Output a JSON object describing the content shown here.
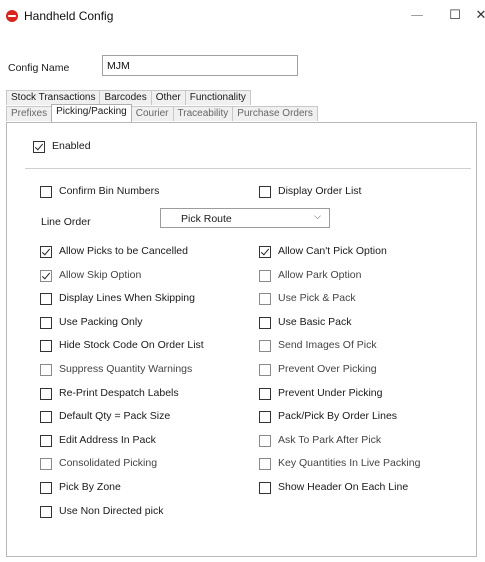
{
  "window": {
    "title": "Handheld Config",
    "minimize": "—",
    "maximize": "☐",
    "close": "✕"
  },
  "config": {
    "label": "Config Name",
    "value": "MJM"
  },
  "tabs_row1": [
    {
      "label": "Stock Transactions"
    },
    {
      "label": "Barcodes"
    },
    {
      "label": "Other"
    },
    {
      "label": "Functionality"
    }
  ],
  "tabs_row2": [
    {
      "label": "Prefixes",
      "active": false
    },
    {
      "label": "Picking/Packing",
      "active": true
    },
    {
      "label": "Courier",
      "active": false
    },
    {
      "label": "Traceability",
      "active": false
    },
    {
      "label": "Purchase Orders",
      "active": false
    }
  ],
  "enabled": {
    "label": "Enabled",
    "checked": true
  },
  "line_order": {
    "label": "Line Order",
    "value": "Pick Route"
  },
  "options": {
    "confirm_bin": {
      "label": "Confirm Bin Numbers",
      "checked": false
    },
    "display_order_list": {
      "label": "Display Order List",
      "checked": false
    },
    "allow_picks_cancelled": {
      "label": "Allow Picks to be Cancelled",
      "checked": true
    },
    "allow_cant_pick": {
      "label": "Allow Can't Pick Option",
      "checked": true
    },
    "allow_skip": {
      "label": "Allow Skip Option",
      "checked": true
    },
    "allow_park": {
      "label": "Allow Park Option",
      "checked": false
    },
    "display_lines_skipping": {
      "label": "Display Lines When Skipping",
      "checked": false
    },
    "use_pick_pack": {
      "label": "Use Pick & Pack",
      "checked": false
    },
    "use_packing_only": {
      "label": "Use Packing Only",
      "checked": false
    },
    "use_basic_pack": {
      "label": "Use Basic Pack",
      "checked": false
    },
    "hide_stock_code": {
      "label": "Hide Stock Code On Order List",
      "checked": false
    },
    "send_images": {
      "label": "Send Images Of Pick",
      "checked": false
    },
    "suppress_qty": {
      "label": "Suppress Quantity Warnings",
      "checked": false
    },
    "prevent_over": {
      "label": "Prevent Over Picking",
      "checked": false
    },
    "reprint_labels": {
      "label": "Re-Print Despatch Labels",
      "checked": false
    },
    "prevent_under": {
      "label": "Prevent Under Picking",
      "checked": false
    },
    "default_qty": {
      "label": "Default Qty = Pack Size",
      "checked": false
    },
    "pack_by_order": {
      "label": "Pack/Pick By Order Lines",
      "checked": false
    },
    "edit_address": {
      "label": "Edit Address In Pack",
      "checked": false
    },
    "ask_to_park": {
      "label": "Ask To Park After Pick",
      "checked": false
    },
    "consolidated": {
      "label": "Consolidated Picking",
      "checked": false
    },
    "key_quantities": {
      "label": "Key Quantities In Live Packing",
      "checked": false
    },
    "pick_by_zone": {
      "label": "Pick By Zone",
      "checked": false
    },
    "show_header": {
      "label": "Show Header On Each Line",
      "checked": false
    },
    "non_directed": {
      "label": "Use Non Directed pick",
      "checked": false
    }
  }
}
